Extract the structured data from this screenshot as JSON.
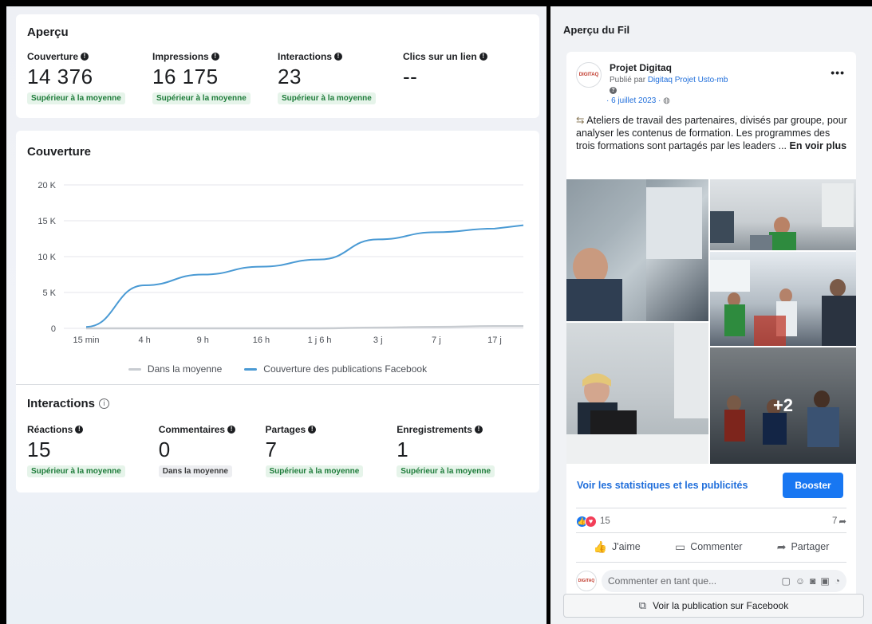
{
  "overview": {
    "title": "Aperçu",
    "metrics": [
      {
        "label": "Couverture",
        "value": "14 376",
        "badge": "Supérieur à la moyenne"
      },
      {
        "label": "Impressions",
        "value": "16 175",
        "badge": "Supérieur à la moyenne"
      },
      {
        "label": "Interactions",
        "value": "23",
        "badge": "Supérieur à la moyenne"
      },
      {
        "label": "Clics sur un lien",
        "value": "--",
        "badge": ""
      }
    ]
  },
  "coverage": {
    "title": "Couverture",
    "legend": [
      "Dans la moyenne",
      "Couverture des publications Facebook"
    ]
  },
  "chart_data": {
    "type": "line",
    "title": "Couverture",
    "x_ticks": [
      "15 min",
      "4 h",
      "9 h",
      "16 h",
      "1 j 6 h",
      "3 j",
      "7 j",
      "17 j"
    ],
    "y_ticks": [
      "0",
      "5 K",
      "10 K",
      "15 K",
      "20 K"
    ],
    "ylim": [
      0,
      20000
    ],
    "grid": true,
    "legend_position": "bottom",
    "series": [
      {
        "name": "Dans la moyenne",
        "color": "#c8ccd1",
        "values": [
          0,
          0,
          0,
          0,
          0,
          100,
          200,
          300
        ]
      },
      {
        "name": "Couverture des publications Facebook",
        "color": "#4a9ad4",
        "values": [
          200,
          6000,
          7500,
          8600,
          9600,
          12400,
          13400,
          13900
        ]
      }
    ]
  },
  "interactions": {
    "title": "Interactions",
    "metrics": [
      {
        "label": "Réactions",
        "value": "15",
        "badge": "Supérieur à la moyenne",
        "neutral": false
      },
      {
        "label": "Commentaires",
        "value": "0",
        "badge": "Dans la moyenne",
        "neutral": true
      },
      {
        "label": "Partages",
        "value": "7",
        "badge": "Supérieur à la moyenne",
        "neutral": false
      },
      {
        "label": "Enregistrements",
        "value": "1",
        "badge": "Supérieur à la moyenne",
        "neutral": false
      }
    ]
  },
  "feed": {
    "title": "Aperçu du Fil",
    "page_name": "Projet Digitaq",
    "avatar_text": "DIGITAQ",
    "published_prefix": "Publié par",
    "published_by": "Digitaq Projet Usto-mb",
    "date": "· 6 juillet 2023 ·",
    "text": "Ateliers de travail des partenaires,  divisés par groupe,  pour analyser les contenus de formation. Les programmes des trois formations sont partagés par les leaders ...",
    "see_more": "En voir plus",
    "extra_photos": "+2",
    "stats_link": "Voir les statistiques et les publicités",
    "boost": "Booster",
    "reaction_count": "15",
    "share_count": "7",
    "like": "J'aime",
    "comment": "Commenter",
    "share": "Partager",
    "comment_placeholder": "Commenter en tant que...",
    "view_on_facebook": "Voir la publication sur Facebook"
  },
  "colors": {
    "accent": "#1877f2",
    "link": "#216fdb",
    "badge_green": "#1e7c3a",
    "series_line": "#4a9ad4"
  }
}
